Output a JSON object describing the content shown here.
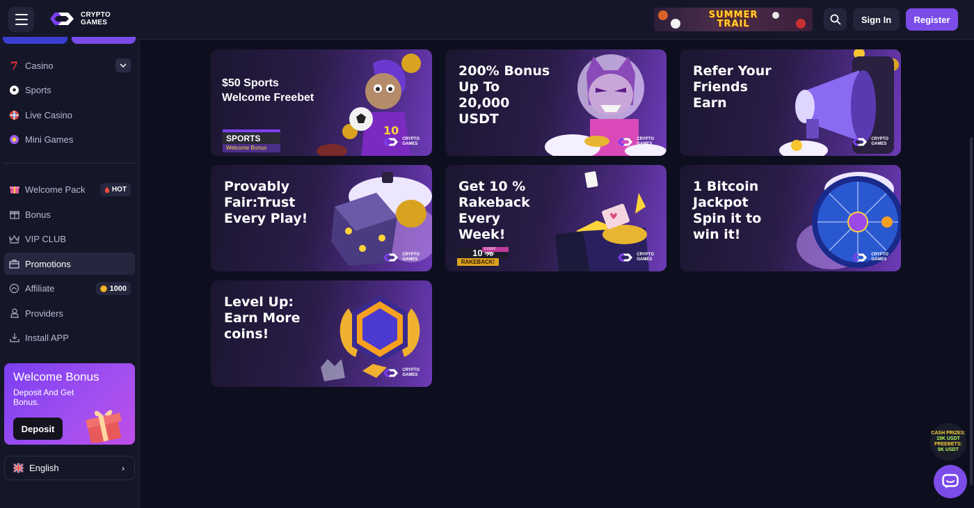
{
  "header": {
    "logo_line1": "CRYPTO",
    "logo_line2": "GAMES",
    "banner_line1": "SUMMER",
    "banner_line2": "TRAIL",
    "signin_label": "Sign In",
    "register_label": "Register",
    "accent_color": "#7b4ce8"
  },
  "sidebar": {
    "games": [
      {
        "label": "Casino",
        "icon": "seven-icon"
      },
      {
        "label": "Sports",
        "icon": "soccer-ball-icon"
      },
      {
        "label": "Live Casino",
        "icon": "live-chip-icon"
      },
      {
        "label": "Mini Games",
        "icon": "mini-games-icon"
      }
    ],
    "items": [
      {
        "label": "Welcome Pack",
        "icon": "gift-icon",
        "badge": "HOT"
      },
      {
        "label": "Bonus",
        "icon": "bonus-gift-icon"
      },
      {
        "label": "VIP CLUB",
        "icon": "crown-icon"
      },
      {
        "label": "Promotions",
        "icon": "promotions-icon"
      },
      {
        "label": "Affiliate",
        "icon": "affiliate-icon",
        "badge": "1000"
      },
      {
        "label": "Providers",
        "icon": "providers-icon"
      },
      {
        "label": "Install APP",
        "icon": "install-icon"
      }
    ],
    "welcome_bonus": {
      "title": "Welcome Bonus",
      "subtitle": "Deposit And Get Bonus.",
      "button": "Deposit"
    },
    "language": "English"
  },
  "promotions": [
    {
      "title": "$50 Sports\nWelcome Freebet",
      "tag1": "SPORTS",
      "tag2": "Welcome Bonus"
    },
    {
      "title": "200% Bonus\nUp To\n20,000\nUSDT"
    },
    {
      "title": "Refer Your\nFriends\nEarn"
    },
    {
      "title": "Provably\nFair:Trust\nEvery Play!"
    },
    {
      "title": "Get 10 %\nRakeback\nEvery\nWeek!",
      "tag_small": "EVERY WEEK",
      "tag_big": "10 %",
      "tag_bottom": "RAKEBACK!"
    },
    {
      "title": "1 Bitcoin\nJackpot\nSpin it to\nwin it!"
    },
    {
      "title": "Level Up:\nEarn More\ncoins!"
    }
  ],
  "promo_logo": {
    "line1": "CRYPTO",
    "line2": "GAMES"
  },
  "floating": {
    "line1": "CASH PRIZES:",
    "line2": "15K USDT",
    "line3": "FREEBETS:",
    "line4": "5K USDT"
  }
}
